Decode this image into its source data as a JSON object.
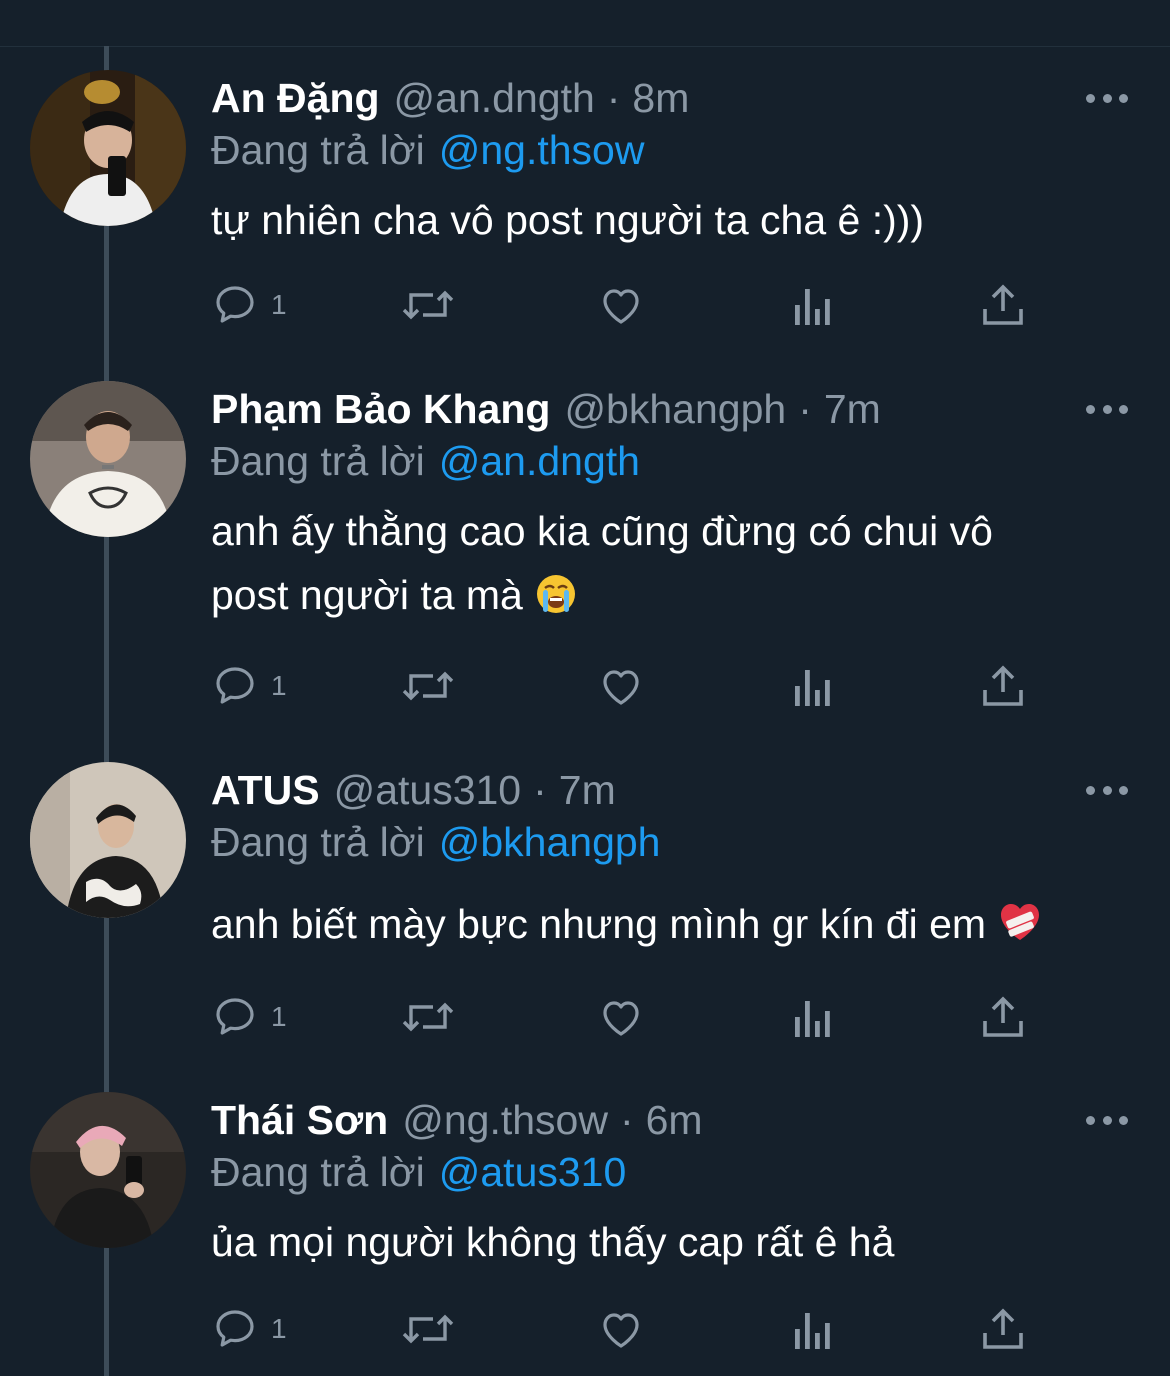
{
  "colors": {
    "background": "#15202b",
    "text_primary": "#ffffff",
    "text_secondary": "#8b98a5",
    "mention": "#1d9bf0",
    "thread_line": "#3d4c59"
  },
  "icons": {
    "reply": "comment-bubble-icon",
    "retweet": "retweet-icon",
    "like": "heart-icon",
    "views": "bar-chart-icon",
    "share": "share-upload-icon",
    "more": "more-dots-icon"
  },
  "replying_label": "Đang trả lời",
  "tweets": [
    {
      "name": "An Đặng",
      "handle": "@an.dngth",
      "separator": "·",
      "time": "8m",
      "reply_to": "@ng.thsow",
      "text_lines": [
        "tự nhiên cha vô post người ta cha ê :)))"
      ],
      "emoji": "",
      "reply_count": "1"
    },
    {
      "name": "Phạm Bảo Khang",
      "handle": "@bkhangph",
      "separator": "·",
      "time": "7m",
      "reply_to": "@an.dngth",
      "text_lines": [
        "anh ấy thằng cao kia cũng đừng có chui vô",
        "post người ta mà"
      ],
      "emoji": "loudly-crying-face",
      "reply_count": "1"
    },
    {
      "name": "ATUS",
      "handle": "@atus310",
      "separator": "·",
      "time": "7m",
      "reply_to": "@bkhangph",
      "text_lines": [
        "anh biết mày bực nhưng mình gr kín đi em"
      ],
      "emoji": "mending-heart",
      "reply_count": "1"
    },
    {
      "name": "Thái Sơn",
      "handle": "@ng.thsow",
      "separator": "·",
      "time": "6m",
      "reply_to": "@atus310",
      "text_lines": [
        "ủa mọi người không thấy cap rất ê hả"
      ],
      "emoji": "",
      "reply_count": "1"
    }
  ]
}
